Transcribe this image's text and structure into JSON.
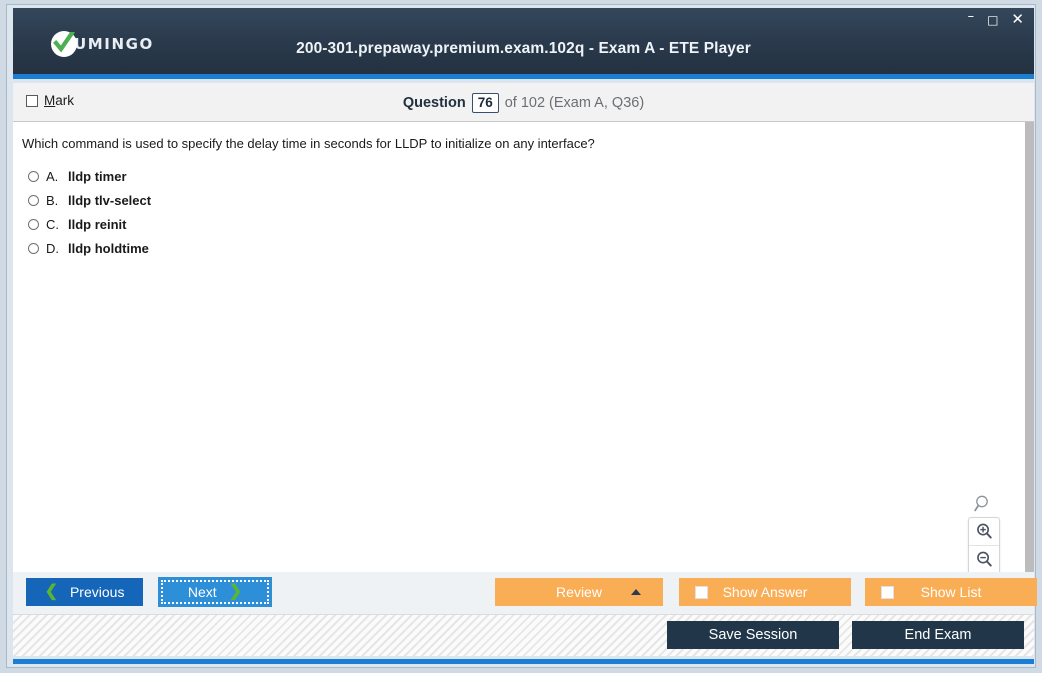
{
  "window": {
    "title": "200-301.prepaway.premium.exam.102q - Exam A - ETE Player",
    "controls": {
      "minimize": "–",
      "maximize": "□",
      "close": "✕"
    }
  },
  "brand": {
    "name": "UMINGO",
    "logo_icon": "check-circle-icon",
    "accent_color": "#4caf50"
  },
  "header": {
    "mark_label_accel": "M",
    "mark_label_rest": "ark",
    "question_word": "Question",
    "question_number": "76",
    "question_tail": "of 102 (Exam A, Q36)"
  },
  "question": {
    "text": "Which command is used to specify the delay time in seconds for LLDP to initialize on any interface?",
    "options": [
      {
        "letter": "A.",
        "text": "lldp timer"
      },
      {
        "letter": "B.",
        "text": "lldp tlv-select"
      },
      {
        "letter": "C.",
        "text": "lldp reinit"
      },
      {
        "letter": "D.",
        "text": "lldp holdtime"
      }
    ]
  },
  "zoom_tools": {
    "search_icon": "magnifier-icon",
    "zoom_in_icon": "zoom-in-icon",
    "zoom_out_icon": "zoom-out-icon"
  },
  "toolbar": {
    "previous_label": "Previous",
    "next_label": "Next",
    "review_label": "Review",
    "show_answer_label": "Show Answer",
    "show_list_label": "Show List"
  },
  "footer": {
    "save_session_label": "Save Session",
    "end_exam_label": "End Exam"
  },
  "colors": {
    "titlebar_dark": "#2b3b4d",
    "accent_blue": "#1a7fd4",
    "orange": "#f9ae56",
    "green_chevron": "#5cb530",
    "prev_blue": "#1565b8",
    "next_blue": "#2e8fd9",
    "dark_button": "#22364a"
  }
}
